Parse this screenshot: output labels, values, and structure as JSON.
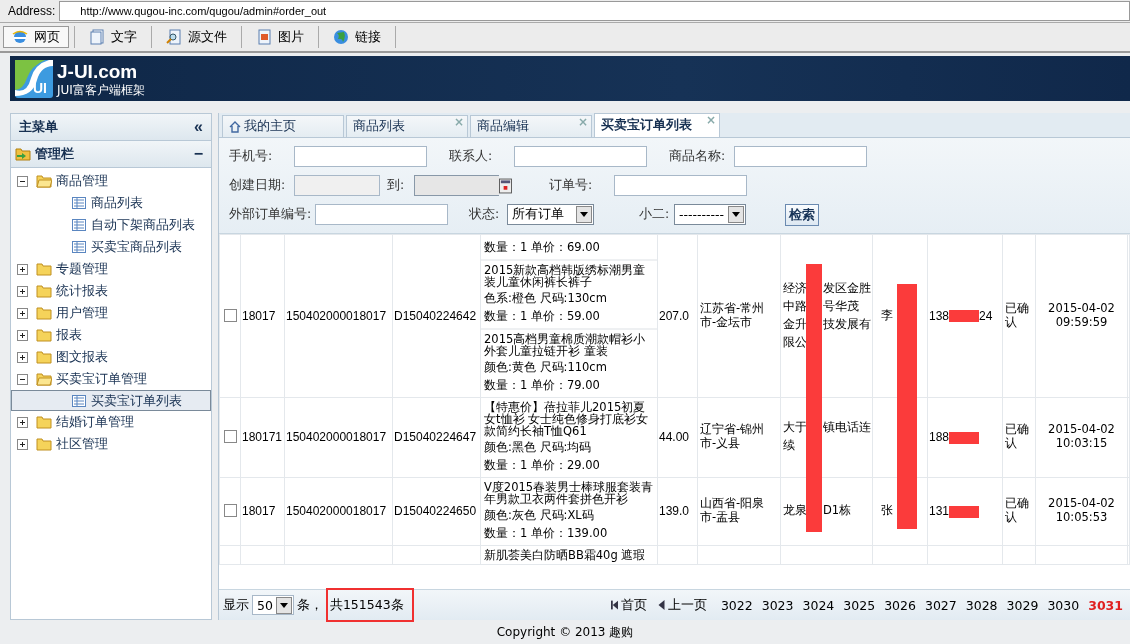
{
  "address_bar": {
    "label": "Address:",
    "url": "http://www.qugou-inc.com/qugou/admin#order_out"
  },
  "toolbar": [
    {
      "label": "网页",
      "selected": true
    },
    {
      "label": "文字",
      "selected": false
    },
    {
      "label": "源文件",
      "selected": false
    },
    {
      "label": "图片",
      "selected": false
    },
    {
      "label": "链接",
      "selected": false
    }
  ],
  "header": {
    "logo_text": "UI",
    "title": "J-UI.com",
    "subtitle": "JUI富客户端框架"
  },
  "sidebar": {
    "title": "主菜单",
    "collapse": "«",
    "panel": "管理栏",
    "panel_toggle": "−",
    "tree": [
      {
        "label": "商品管理",
        "expanded": true,
        "children": [
          {
            "label": "商品列表",
            "selected": false
          },
          {
            "label": "自动下架商品列表",
            "selected": false
          },
          {
            "label": "买卖宝商品列表",
            "selected": false
          }
        ]
      },
      {
        "label": "专题管理",
        "expanded": false
      },
      {
        "label": "统计报表",
        "expanded": false
      },
      {
        "label": "用户管理",
        "expanded": false
      },
      {
        "label": "报表",
        "expanded": false
      },
      {
        "label": "图文报表",
        "expanded": false
      },
      {
        "label": "买卖宝订单管理",
        "expanded": true,
        "children": [
          {
            "label": "买卖宝订单列表",
            "selected": true
          }
        ]
      },
      {
        "label": "结婚订单管理",
        "expanded": false
      },
      {
        "label": "社区管理",
        "expanded": false
      }
    ]
  },
  "tabs": [
    {
      "label": "我的主页",
      "kind": "home",
      "selected": false
    },
    {
      "label": "商品列表",
      "kind": "page",
      "close": "×",
      "selected": false
    },
    {
      "label": "商品编辑",
      "kind": "page",
      "close": "×",
      "selected": false
    },
    {
      "label": "买卖宝订单列表",
      "kind": "page",
      "close": "×",
      "selected": true
    }
  ],
  "search_form": [
    [
      {
        "kind": "text",
        "label": "手机号:"
      },
      {
        "kind": "text",
        "label": "联系人:"
      },
      {
        "kind": "text",
        "label": "商品名称:"
      }
    ],
    [
      {
        "kind": "date",
        "label": "创建日期:",
        "calendar": false
      },
      {
        "kind": "date",
        "label": "到:",
        "calendar": true
      },
      {
        "kind": "text",
        "label": "订单号:"
      }
    ],
    [
      {
        "kind": "text",
        "label": "外部订单编号:"
      },
      {
        "kind": "select",
        "label": "状态:",
        "value": "所有订单"
      },
      {
        "kind": "select",
        "label": "小二:",
        "value": "----------"
      },
      {
        "kind": "button",
        "label": "检索"
      }
    ]
  ],
  "orders": [
    {
      "checked": false,
      "id": "18017",
      "order_no": "150402000018017",
      "external_no": "D15040224642",
      "products": [
        {
          "lines": [
            "数量：1  单价：69.00"
          ]
        },
        {
          "title": "2015新款高档韩版绣标潮男童装儿童休闲裤长裤子",
          "lines": [
            "色系:橙色 尺码:130cm",
            "数量：1  单价：59.00"
          ]
        },
        {
          "title": "2015高档男童棉质潮款帽衫小外套儿童拉链开衫 童装",
          "lines": [
            "颜色:黄色 尺码:110cm",
            "数量：1  单价：79.00"
          ]
        }
      ],
      "amount": "207.0",
      "region": "江苏省-常州市-金坛市",
      "address": [
        [
          "经济",
          "发区金胜"
        ],
        [
          "中路",
          "号华茂"
        ],
        [
          "金升",
          "技发展有"
        ],
        [
          "限公"
        ]
      ],
      "name": "李",
      "phone": [
        "138",
        "24"
      ],
      "status": "已确认",
      "time": [
        "2015-04-02",
        "09:59:59"
      ]
    },
    {
      "checked": false,
      "id": "180171",
      "order_no": "150402000018017",
      "external_no": "D15040224647",
      "products": [
        {
          "title": "【特惠价】蓓拉菲儿2015初夏女t恤衫 女士纯色修身打底衫女款简约长袖T恤Q61",
          "lines": [
            "颜色:黑色 尺码:均码",
            "数量：1  单价：29.00"
          ]
        }
      ],
      "amount": "44.00",
      "region": "辽宁省-锦州市-义县",
      "address": [
        [
          "大于",
          "镇电话连"
        ],
        [
          "续"
        ]
      ],
      "phone": [
        "188"
      ],
      "status": "已确认",
      "time": [
        "2015-04-02",
        "10:03:15"
      ]
    },
    {
      "checked": false,
      "id": "18017",
      "order_no": "150402000018017",
      "external_no": "D15040224650",
      "products": [
        {
          "title": "V度2015春装男士棒球服套装青年男款卫衣两件套拼色开衫",
          "lines": [
            "颜色:灰色 尺码:XL码",
            "数量：1  单价：139.00"
          ]
        }
      ],
      "amount": "139.0",
      "region": "山西省-阳泉市-盂县",
      "address": [
        [
          "龙泉",
          "D1栋"
        ]
      ],
      "name": "张",
      "phone": [
        "131"
      ],
      "status": "已确认",
      "time": [
        "2015-04-02",
        "10:05:53"
      ]
    },
    {
      "products": [
        {
          "title": "新肌荟美白防晒BB霜40g 遮瑕"
        }
      ]
    }
  ],
  "pager": {
    "show": "显示",
    "page_size": "50",
    "unit": "条，",
    "total": "共151543条",
    "first": "首页",
    "prev": "上一页",
    "pages": [
      {
        "label": "3022",
        "selected": false
      },
      {
        "label": "3023",
        "selected": false
      },
      {
        "label": "3024",
        "selected": false
      },
      {
        "label": "3025",
        "selected": false
      },
      {
        "label": "3026",
        "selected": false
      },
      {
        "label": "3027",
        "selected": false
      },
      {
        "label": "3028",
        "selected": false
      },
      {
        "label": "3029",
        "selected": false
      },
      {
        "label": "3030",
        "selected": false
      },
      {
        "label": "3031",
        "selected": true
      }
    ]
  },
  "footer": "Copyright © 2013 趣购"
}
